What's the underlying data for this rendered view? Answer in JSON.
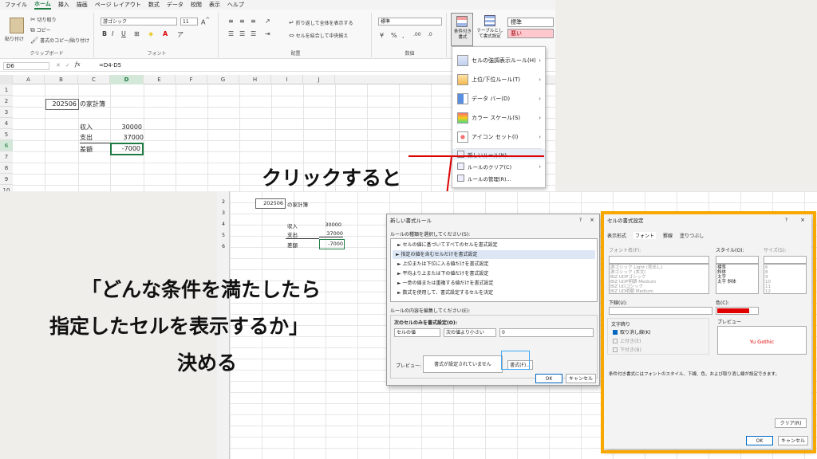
{
  "menu": {
    "items": [
      "ファイル",
      "ホーム",
      "挿入",
      "描画",
      "ページ レイアウト",
      "数式",
      "データ",
      "校閲",
      "表示",
      "ヘルプ"
    ],
    "active": 1
  },
  "ribbon": {
    "paste": "貼り付け",
    "cut": "切り取り",
    "copy": "コピー",
    "format_painter": "書式のコピー/貼り付け",
    "clipboard_label": "クリップボード",
    "font_name": "游ゴシック",
    "font_size": "11",
    "font_label": "フォント",
    "wrap_text": "折り返して全体を表示する",
    "merge_center": "セルを結合して中央揃え",
    "alignment_label": "配置",
    "number_format": "標準",
    "number_label": "数値",
    "cond_format": "条件付き書式",
    "table_format": "テーブルとして書式設定",
    "style_normal": "標準",
    "style_bad": "悪い"
  },
  "formula_bar": {
    "name_box": "D6",
    "fx": "fx",
    "formula": "=D4-D5"
  },
  "grid": {
    "columns": [
      "A",
      "B",
      "C",
      "D",
      "E",
      "F",
      "G",
      "H",
      "I",
      "J"
    ],
    "rows": [
      "1",
      "2",
      "3",
      "4",
      "5",
      "6",
      "7",
      "8",
      "9",
      "10",
      "11",
      "12"
    ],
    "title": "202506",
    "title_suffix": "の家計簿",
    "income_label": "収入",
    "income_value": "30000",
    "expense_label": "支出",
    "expense_value": "37000",
    "diff_label": "差額",
    "diff_value": "-7000"
  },
  "cf_menu": {
    "items": [
      {
        "label": "セルの強調表示ルール(H)",
        "icon": "highlight-rules-icon"
      },
      {
        "label": "上位/下位ルール(T)",
        "icon": "top-bottom-icon"
      },
      {
        "label": "データ バー(D)",
        "icon": "data-bar-icon"
      },
      {
        "label": "カラー スケール(S)",
        "icon": "color-scale-icon"
      },
      {
        "label": "アイコン セット(I)",
        "icon": "icon-set-icon"
      }
    ],
    "new_rule": "新しいルール(N)...",
    "clear_rules": "ルールのクリア(C)",
    "manage_rules": "ルールの管理(R)..."
  },
  "annotations": {
    "click": "クリックすると",
    "line1": "「どんな条件を満たしたら",
    "line2": "指定したセルを表示するか」",
    "line3": "決める"
  },
  "sheet2": {
    "rows": [
      "2",
      "3",
      "4",
      "5",
      "6",
      "7",
      "8",
      "9",
      "10",
      "11",
      "12",
      "13",
      "14",
      "15",
      "16",
      "17",
      "18",
      "19",
      "20",
      "21",
      "22",
      "23",
      "24",
      "25"
    ],
    "title": "202506",
    "title_suffix": "の家計簿",
    "income_label": "収入",
    "income_value": "30000",
    "expense_label": "支出",
    "expense_value": "37000",
    "diff_label": "差額",
    "diff_value": "-7000"
  },
  "new_rule_dialog": {
    "title": "新しい書式ルール",
    "help": "?",
    "close": "×",
    "select_type": "ルールの種類を選択してください(S):",
    "rules": [
      "► セルの値に基づいてすべてのセルを書式設定",
      "► 指定の値を含むセルだけを書式設定",
      "► 上位または下位に入る値だけを書式設定",
      "► 平均より上または下の値だけを書式設定",
      "► 一意の値または重複する値だけを書式設定",
      "► 数式を使用して、書式設定するセルを決定"
    ],
    "edit_rule": "ルールの内容を編集してください(E):",
    "format_only": "次のセルのみを書式設定(O):",
    "cond1": "セルの値",
    "cond2": "次の値より小さい",
    "value": "0",
    "preview_label": "プレビュー:",
    "preview_text": "書式が設定されていません",
    "format_button": "書式(F)...",
    "ok": "OK",
    "cancel": "キャンセル"
  },
  "format_cells_dialog": {
    "title": "セルの書式設定",
    "help": "?",
    "close": "×",
    "tabs": [
      "表示形式",
      "フォント",
      "罫線",
      "塗りつぶし"
    ],
    "active_tab": 1,
    "font_name_label": "フォント名(F):",
    "font_style_label": "スタイル(O):",
    "size_label": "サイズ(S):",
    "fonts": [
      "游ゴシック Light (見出し)",
      "游ゴシック (本文)",
      "BIZ UDPゴシック",
      "BIZ UDP明朝 Medium",
      "BIZ UDゴシック",
      "BIZ UD明朝 Medium"
    ],
    "styles": [
      "標準",
      "斜体",
      "太字",
      "太字 斜体"
    ],
    "sizes": [
      "6",
      "8",
      "9",
      "10",
      "11",
      "12"
    ],
    "underline_label": "下線(U):",
    "color_label": "色(C):",
    "color_value": "#e00000",
    "effects_label": "文字飾り",
    "strike": "取り消し線(K)",
    "superscript": "上付き(E)",
    "subscript": "下付き(B)",
    "preview_label": "プレビュー",
    "preview_text": "Yu Gothic",
    "note": "条件付き書式にはフォントのスタイル、下線、色、および取り消し線が設定できます。",
    "clear": "クリア(R)",
    "ok": "OK",
    "cancel": "キャンセル"
  }
}
